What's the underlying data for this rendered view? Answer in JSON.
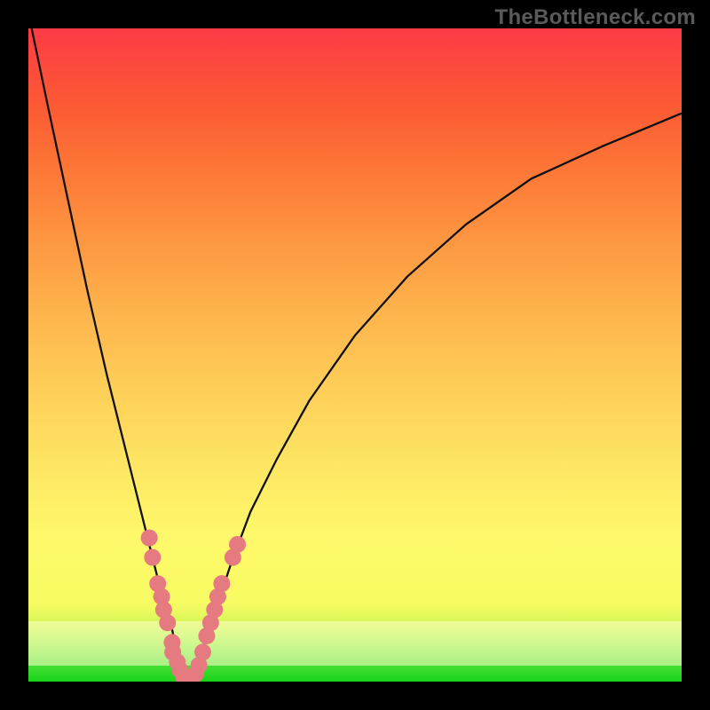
{
  "watermark": "TheBottleneck.com",
  "colors": {
    "marker": "#e57a81",
    "line": "#111111",
    "frame": "#000000"
  },
  "chart_data": {
    "type": "line",
    "title": "",
    "xlabel": "",
    "ylabel": "",
    "xlim": [
      0,
      100
    ],
    "ylim": [
      0,
      100
    ],
    "grid": false,
    "legend": false,
    "note": "V-shaped bottleneck curve; minimum (0% bottleneck) around x≈24. Left branch steeper than right. Values estimated from pixel positions on a 0–100 y-axis where 0 is bottom.",
    "x": [
      0.5,
      3,
      6,
      9,
      12,
      15,
      18,
      20,
      22,
      23,
      24,
      25,
      26,
      27,
      29,
      31,
      34,
      38,
      43,
      50,
      58,
      67,
      77,
      88,
      100
    ],
    "y": [
      100,
      88,
      74,
      60,
      47,
      35,
      23,
      15,
      8,
      3,
      0,
      1,
      3,
      6,
      12,
      18,
      26,
      34,
      43,
      53,
      62,
      70,
      77,
      82,
      87
    ],
    "markers": {
      "note": "Salmon dot clusters near the valley on both branches",
      "points": [
        {
          "x": 18.5,
          "y": 22
        },
        {
          "x": 19.0,
          "y": 19
        },
        {
          "x": 19.8,
          "y": 15
        },
        {
          "x": 20.4,
          "y": 13
        },
        {
          "x": 20.7,
          "y": 11
        },
        {
          "x": 21.3,
          "y": 9
        },
        {
          "x": 22.0,
          "y": 6
        },
        {
          "x": 22.1,
          "y": 4.5
        },
        {
          "x": 22.8,
          "y": 3
        },
        {
          "x": 23.2,
          "y": 1.8
        },
        {
          "x": 23.8,
          "y": 0.6
        },
        {
          "x": 24.3,
          "y": 0.3
        },
        {
          "x": 25.0,
          "y": 0.5
        },
        {
          "x": 25.6,
          "y": 1.2
        },
        {
          "x": 26.1,
          "y": 2.5
        },
        {
          "x": 26.7,
          "y": 4.5
        },
        {
          "x": 27.3,
          "y": 7
        },
        {
          "x": 27.9,
          "y": 9
        },
        {
          "x": 28.5,
          "y": 11
        },
        {
          "x": 29.0,
          "y": 13
        },
        {
          "x": 29.6,
          "y": 15
        },
        {
          "x": 31.3,
          "y": 19
        },
        {
          "x": 32.0,
          "y": 21
        }
      ]
    }
  }
}
